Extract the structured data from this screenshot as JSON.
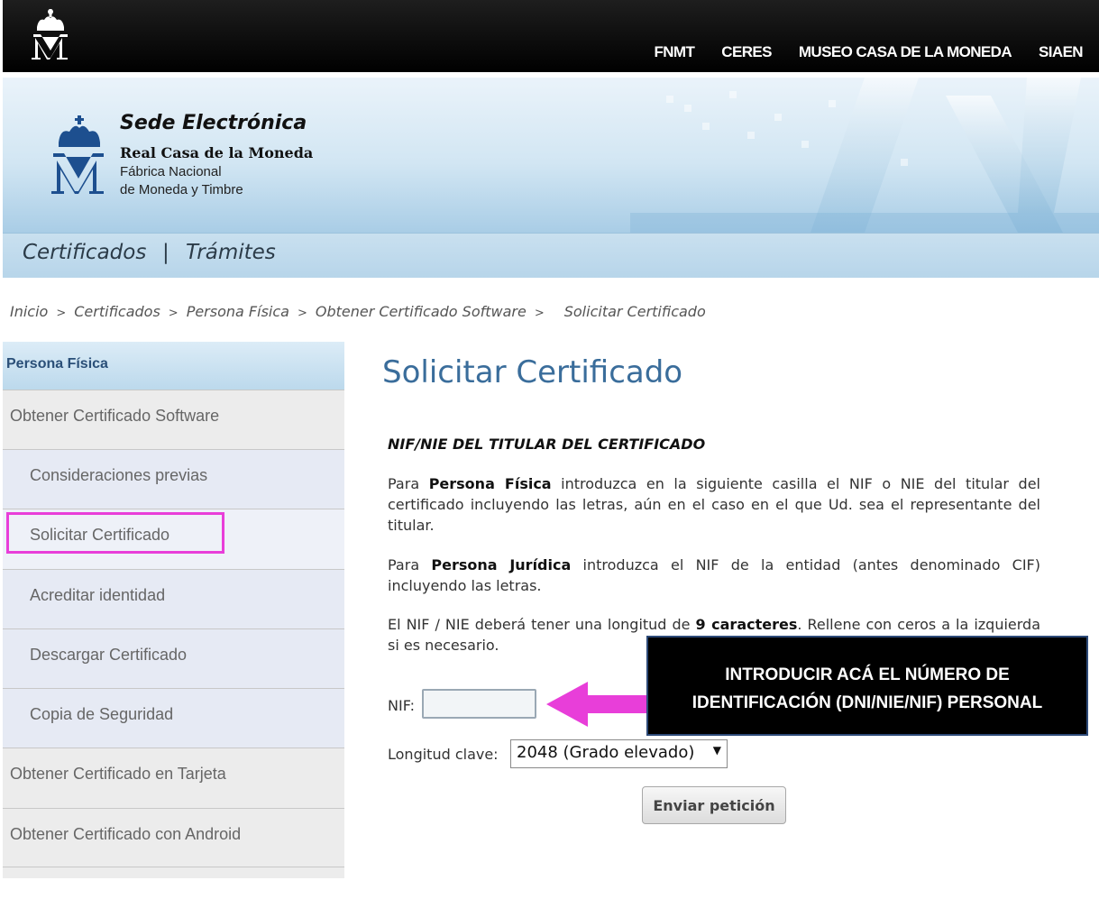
{
  "top_nav": [
    "FNMT",
    "CERES",
    "MUSEO CASA DE LA MONEDA",
    "SIAEN"
  ],
  "banner": {
    "title": "Sede Electrónica",
    "subtitle": "Real Casa de la Moneda",
    "line2": "Fábrica Nacional",
    "line3": "de Moneda y Timbre"
  },
  "nav": {
    "item1": "Certificados",
    "sep": "|",
    "item2": "Trámites"
  },
  "breadcrumb": {
    "items": [
      "Inicio",
      "Certificados",
      "Persona Física",
      "Obtener Certificado Software",
      "Solicitar Certificado"
    ],
    "sep": ">"
  },
  "sidebar": {
    "header": "Persona Física",
    "items": [
      "Obtener Certificado Software",
      "Consideraciones previas",
      "Solicitar Certificado",
      "Acreditar identidad",
      "Descargar Certificado",
      "Copia de Seguridad",
      "Obtener Certificado en Tarjeta",
      "Obtener Certificado con Android"
    ]
  },
  "main": {
    "title": "Solicitar Certificado",
    "section_heading": "NIF/NIE DEL TITULAR DEL CERTIFICADO",
    "p1": {
      "a": "Para ",
      "b": "Persona Física",
      "c": " introduzca en la siguiente casilla el NIF o NIE del titular del certificado incluyendo las letras, aún en el caso en el que Ud. sea el representante del titular."
    },
    "p2": {
      "a": "Para ",
      "b": "Persona Jurídica",
      "c": " introduzca el NIF de la entidad (antes denominado CIF) incluyendo las letras."
    },
    "p3": {
      "a": "El NIF / NIE deberá tener una longitud de ",
      "b": "9 caracteres",
      "c": ". Rellene con ceros a la izquierda si es necesario."
    },
    "nif_label": "NIF:",
    "nif_value": "",
    "clave_label": "Longitud clave:",
    "clave_value": "2048 (Grado elevado)",
    "submit_label": "Enviar petición"
  },
  "annotation": {
    "line1": "INTRODUCIR ACÁ EL NÚMERO DE",
    "line2": "IDENTIFICACIÓN (DNI/NIE/NIF) PERSONAL"
  },
  "colors": {
    "highlight": "#e83ed9",
    "title_blue": "#3a6d9b",
    "sidebar_header_text": "#2a4f78"
  }
}
